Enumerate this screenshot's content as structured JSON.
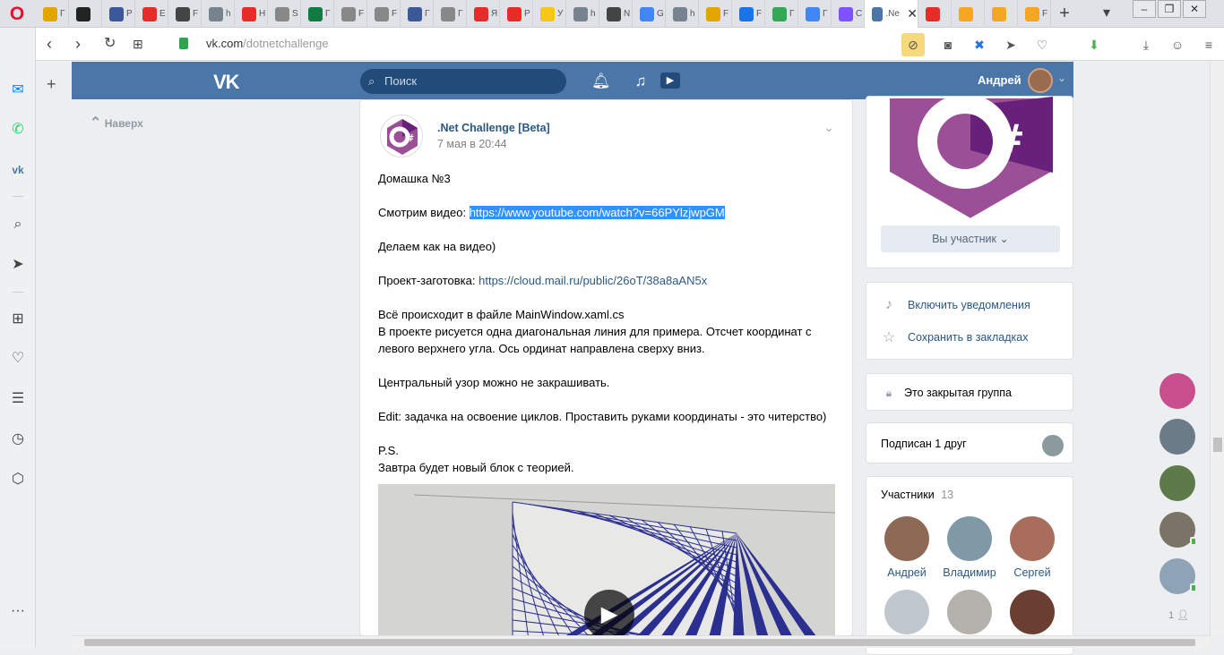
{
  "browser": {
    "tabs": [
      {
        "icon": "mail-icon",
        "label": "Г",
        "color": "#e2a600"
      },
      {
        "icon": "spy-icon",
        "label": "",
        "color": "#222222"
      },
      {
        "icon": "news-icon",
        "label": "Р",
        "color": "#3b5998"
      },
      {
        "icon": "youtube-icon",
        "label": "Е",
        "color": "#e52d27"
      },
      {
        "icon": "x-icon",
        "label": "F",
        "color": "#444444"
      },
      {
        "icon": "habr-icon",
        "label": "h",
        "color": "#77838f"
      },
      {
        "icon": "youtube-icon",
        "label": "Н",
        "color": "#e52d27"
      },
      {
        "icon": "cap-icon",
        "label": "S",
        "color": "#888888"
      },
      {
        "icon": "table-icon",
        "label": "Г",
        "color": "#107c41"
      },
      {
        "icon": "doc-icon",
        "label": "F",
        "color": "#888888"
      },
      {
        "icon": "cap-icon",
        "label": "F",
        "color": "#888888"
      },
      {
        "icon": "globe-icon",
        "label": "Г",
        "color": "#3b5998"
      },
      {
        "icon": "doc-icon",
        "label": "Г",
        "color": "#888888"
      },
      {
        "icon": "yandex-icon",
        "label": "Я",
        "color": "#e52d27"
      },
      {
        "icon": "pdf-icon",
        "label": "Р",
        "color": "#e52d27"
      },
      {
        "icon": "play-icon",
        "label": "У",
        "color": "#f5c518"
      },
      {
        "icon": "habr-icon",
        "label": "h",
        "color": "#77838f"
      },
      {
        "icon": "pen-icon",
        "label": "N",
        "color": "#444444"
      },
      {
        "icon": "chrome-icon",
        "label": "G",
        "color": "#4285f4"
      },
      {
        "icon": "habr-icon",
        "label": "h",
        "color": "#77838f"
      },
      {
        "icon": "people-icon",
        "label": "F",
        "color": "#e2a600"
      },
      {
        "icon": "shield-icon",
        "label": "F",
        "color": "#1a73e8"
      },
      {
        "icon": "drive-icon",
        "label": "Г",
        "color": "#34a853"
      },
      {
        "icon": "docs-icon",
        "label": "Г",
        "color": "#4285f4"
      },
      {
        "icon": "kotlin-icon",
        "label": "С",
        "color": "#7f52ff"
      },
      {
        "icon": "vk-icon",
        "label": ".Ne",
        "color": "#4a76a8",
        "active": true
      },
      {
        "icon": "grid-icon",
        "label": "",
        "color": "#e52d27"
      },
      {
        "icon": "home-icon",
        "label": "",
        "color": "#f5a623"
      },
      {
        "icon": "home-icon",
        "label": "",
        "color": "#f5a623"
      },
      {
        "icon": "home-icon",
        "label": "F",
        "color": "#f5a623"
      }
    ],
    "new_tab": "+",
    "tab_menu": "▾",
    "url_host": "vk.com",
    "url_path": "/dotnetchallenge"
  },
  "vk": {
    "search_placeholder": "Поиск",
    "user_name": "Андрей",
    "back_up": "Наверх"
  },
  "post": {
    "group_name": ".Net Challenge [Beta]",
    "date": "7 мая в 20:44",
    "lines": {
      "l1": "Домашка №3",
      "l2_prefix": "Смотрим видео: ",
      "l2_link": "https://www.youtube.com/watch?v=66PYlzjwpGM",
      "l3": "Делаем как на видео)",
      "l4_prefix": "Проект-заготовка: ",
      "l4_link": "https://cloud.mail.ru/public/26oT/38a8aAN5x",
      "l5": "Всё происходит в файле MainWindow.xaml.cs",
      "l6": "В проекте рисуется одна диагональная линия для примера. Отсчет координат с левого верхнего угла. Ось ординат направлена сверху вниз.",
      "l7": "Центральный узор можно не закрашивать.",
      "l8": "Edit: задачка на освоение циклов. Проставить руками координаты - это читерство)",
      "l9": "P.S.",
      "l10": "Завтра будет новый блок с теорией."
    }
  },
  "right": {
    "member_button": "Вы участник",
    "notify": "Включить уведомления",
    "bookmark": "Сохранить в закладках",
    "closed_group": "Это закрытая группа",
    "subscribed_friend": "Подписан 1 друг",
    "members_title": "Участники",
    "members_count": "13",
    "members": [
      "Андрей",
      "Владимир",
      "Сергей",
      "",
      "",
      ""
    ]
  },
  "friends_online_count": "1",
  "colors": {
    "vk_blue": "#4a76a8",
    "link": "#2a5885",
    "csharp_purple": "#68217a"
  }
}
